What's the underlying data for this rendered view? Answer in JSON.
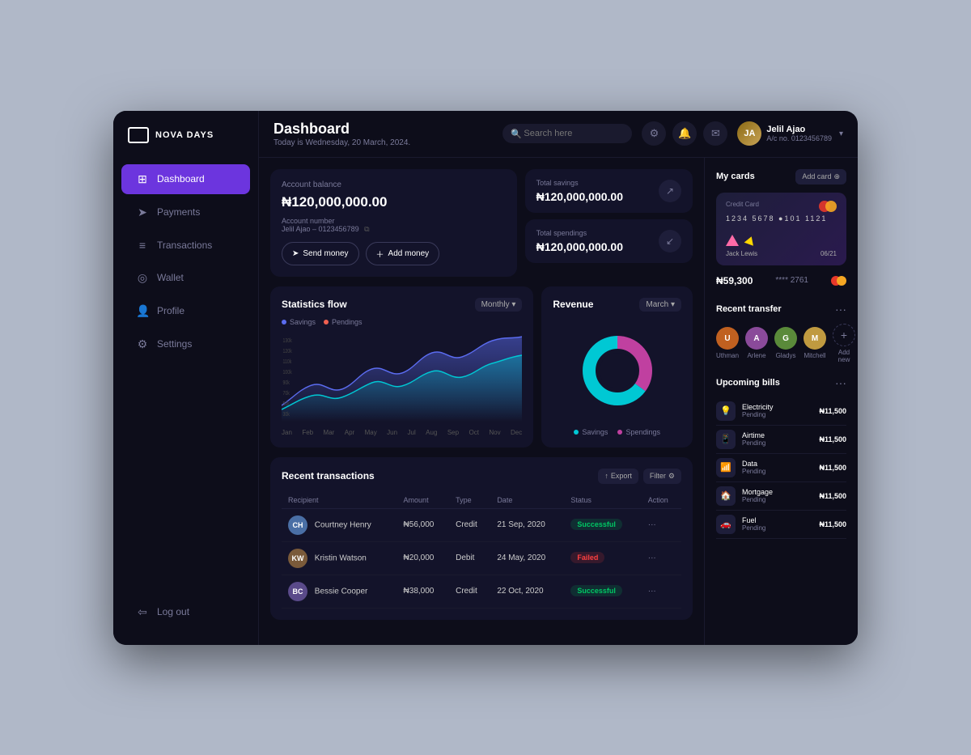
{
  "app": {
    "name": "NOVA DAYS"
  },
  "topbar": {
    "title": "Dashboard",
    "subtitle": "Today is Wednesday, 20 March, 2024.",
    "search_placeholder": "Search here",
    "user": {
      "name": "Jelil Ajao",
      "acno": "A/c no. 0123456789",
      "initials": "JA"
    }
  },
  "sidebar": {
    "items": [
      {
        "label": "Dashboard",
        "icon": "⊞",
        "active": true
      },
      {
        "label": "Payments",
        "icon": "➤"
      },
      {
        "label": "Transactions",
        "icon": "≡"
      },
      {
        "label": "Wallet",
        "icon": "◎"
      },
      {
        "label": "Profile",
        "icon": "👤"
      },
      {
        "label": "Settings",
        "icon": "⚙"
      }
    ],
    "logout": "Log out"
  },
  "balance_card": {
    "label": "Account balance",
    "amount": "₦120,000,000.00",
    "account_label": "Account number",
    "account_holder": "Jelil Ajao – 0123456789",
    "send_btn": "Send money",
    "add_btn": "Add money"
  },
  "savings_card": {
    "label": "Total savings",
    "amount": "₦120,000,000.00"
  },
  "spendings_card": {
    "label": "Total spendings",
    "amount": "₦120,000,000.00"
  },
  "statistics": {
    "title": "Statistics flow",
    "filter": "Monthly",
    "legend": [
      "Savings",
      "Pendings"
    ],
    "x_labels": [
      "Jan",
      "Feb",
      "Mar",
      "Apr",
      "May",
      "Jun",
      "Jul",
      "Aug",
      "Sep",
      "Oct",
      "Nov",
      "Dec"
    ]
  },
  "revenue": {
    "title": "Revenue",
    "filter": "March",
    "savings_pct": 65,
    "spendings_pct": 35,
    "legend_savings": "Savings",
    "legend_spendings": "Spendings"
  },
  "transactions": {
    "title": "Recent transactions",
    "export_btn": "Export",
    "filter_btn": "Filter",
    "columns": [
      "Recipient",
      "Amount",
      "Type",
      "Date",
      "Status",
      "Action"
    ],
    "rows": [
      {
        "name": "Courtney Henry",
        "amount": "₦56,000",
        "type": "Credit",
        "date": "21 Sep, 2020",
        "status": "Successful",
        "initials": "CH",
        "color": "#4a6fa5"
      },
      {
        "name": "Kristin Watson",
        "amount": "₦20,000",
        "type": "Debit",
        "date": "24 May, 2020",
        "status": "Failed",
        "initials": "KW",
        "color": "#7a5a3a"
      },
      {
        "name": "Bessie Cooper",
        "amount": "₦38,000",
        "type": "Credit",
        "date": "22 Oct, 2020",
        "status": "Successful",
        "initials": "BC",
        "color": "#5a4a8a"
      }
    ]
  },
  "my_cards": {
    "title": "My cards",
    "add_card_btn": "Add card",
    "card": {
      "label": "Credit Card",
      "number": "1234  5678  ●101  1121",
      "holder": "Jack Lewis",
      "expiry": "06/21"
    },
    "balance": "₦59,300",
    "last4": "**** 2761"
  },
  "recent_transfer": {
    "title": "Recent transfer",
    "people": [
      {
        "name": "Uthman",
        "initials": "U",
        "color": "#c06020"
      },
      {
        "name": "Arlene",
        "initials": "A",
        "color": "#8a4a9a"
      },
      {
        "name": "Gladys",
        "initials": "G",
        "color": "#5a8a3a"
      },
      {
        "name": "Mitchell",
        "initials": "M",
        "color": "#c09a40"
      },
      {
        "name": "Add new",
        "initials": "+",
        "color": ""
      }
    ]
  },
  "upcoming_bills": {
    "title": "Upcoming bills",
    "items": [
      {
        "name": "Electricity",
        "status": "Pending",
        "amount": "₦11,500",
        "icon": "💡"
      },
      {
        "name": "Airtime",
        "status": "Pending",
        "amount": "₦11,500",
        "icon": "📱"
      },
      {
        "name": "Data",
        "status": "Pending",
        "amount": "₦11,500",
        "icon": "📶"
      },
      {
        "name": "Mortgage",
        "status": "Pending",
        "amount": "₦11,500",
        "icon": "🏠"
      },
      {
        "name": "Fuel",
        "status": "Pending",
        "amount": "₦11,500",
        "icon": "🚗"
      }
    ]
  }
}
